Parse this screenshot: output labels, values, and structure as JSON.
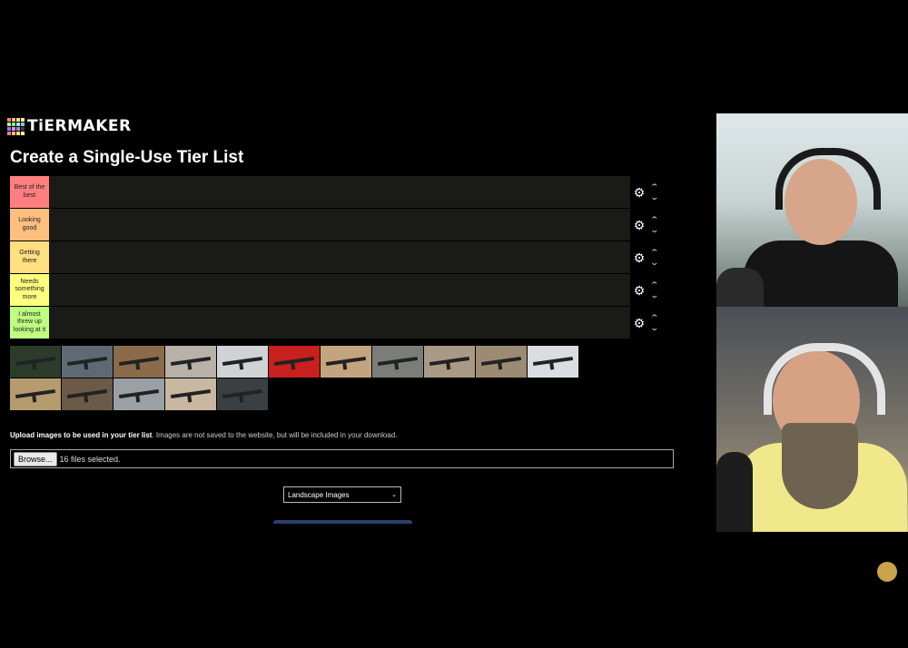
{
  "header": {
    "logo_text": "TiERMAKER",
    "logo_colors": [
      "#ff7f7f",
      "#ffbf7f",
      "#ffdf7f",
      "#ffff7f",
      "#bfff7f",
      "#7fff7f",
      "#7fffff",
      "#7fbfff",
      "#7f7fff",
      "#ff7fff",
      "#bf7fbf",
      "#3b3b3b",
      "#ff7f7f",
      "#ffbf7f",
      "#ffdf7f",
      "#ffff7f"
    ]
  },
  "page_title": "Create a Single-Use Tier List",
  "tiers": [
    {
      "label": "Best of the best",
      "color": "#ff7f7f"
    },
    {
      "label": "Looking good",
      "color": "#ffbf7f"
    },
    {
      "label": "Getting there",
      "color": "#ffdf7f"
    },
    {
      "label": "Needs something more",
      "color": "#ffff7f"
    },
    {
      "label": "I almost threw up looking at it",
      "color": "#bfff7f"
    }
  ],
  "tier_controls": {
    "gear_icon": "gear-icon",
    "up_icon": "chevron-up-icon",
    "down_icon": "chevron-down-icon"
  },
  "image_pool": {
    "count": 16,
    "thumb_colors": [
      "#2c3b2a",
      "#5e6a73",
      "#8b6b4a",
      "#b8b1a8",
      "#cfd3d6",
      "#c81f1f",
      "#c2a57f",
      "#7a7d78",
      "#a89a86",
      "#9c8a73",
      "#d9dde2",
      "#b69b6e",
      "#6b5a48",
      "#9aa0a6",
      "#c9b7a2",
      "#3a3f44"
    ]
  },
  "upload": {
    "note_bold": "Upload images to be used in your tier list",
    "note_rest": ". Images are not saved to the website, but will be included in your download.",
    "browse_label": "Browse...",
    "status": "16 files selected."
  },
  "image_type_select": {
    "value": "Landscape Images"
  }
}
